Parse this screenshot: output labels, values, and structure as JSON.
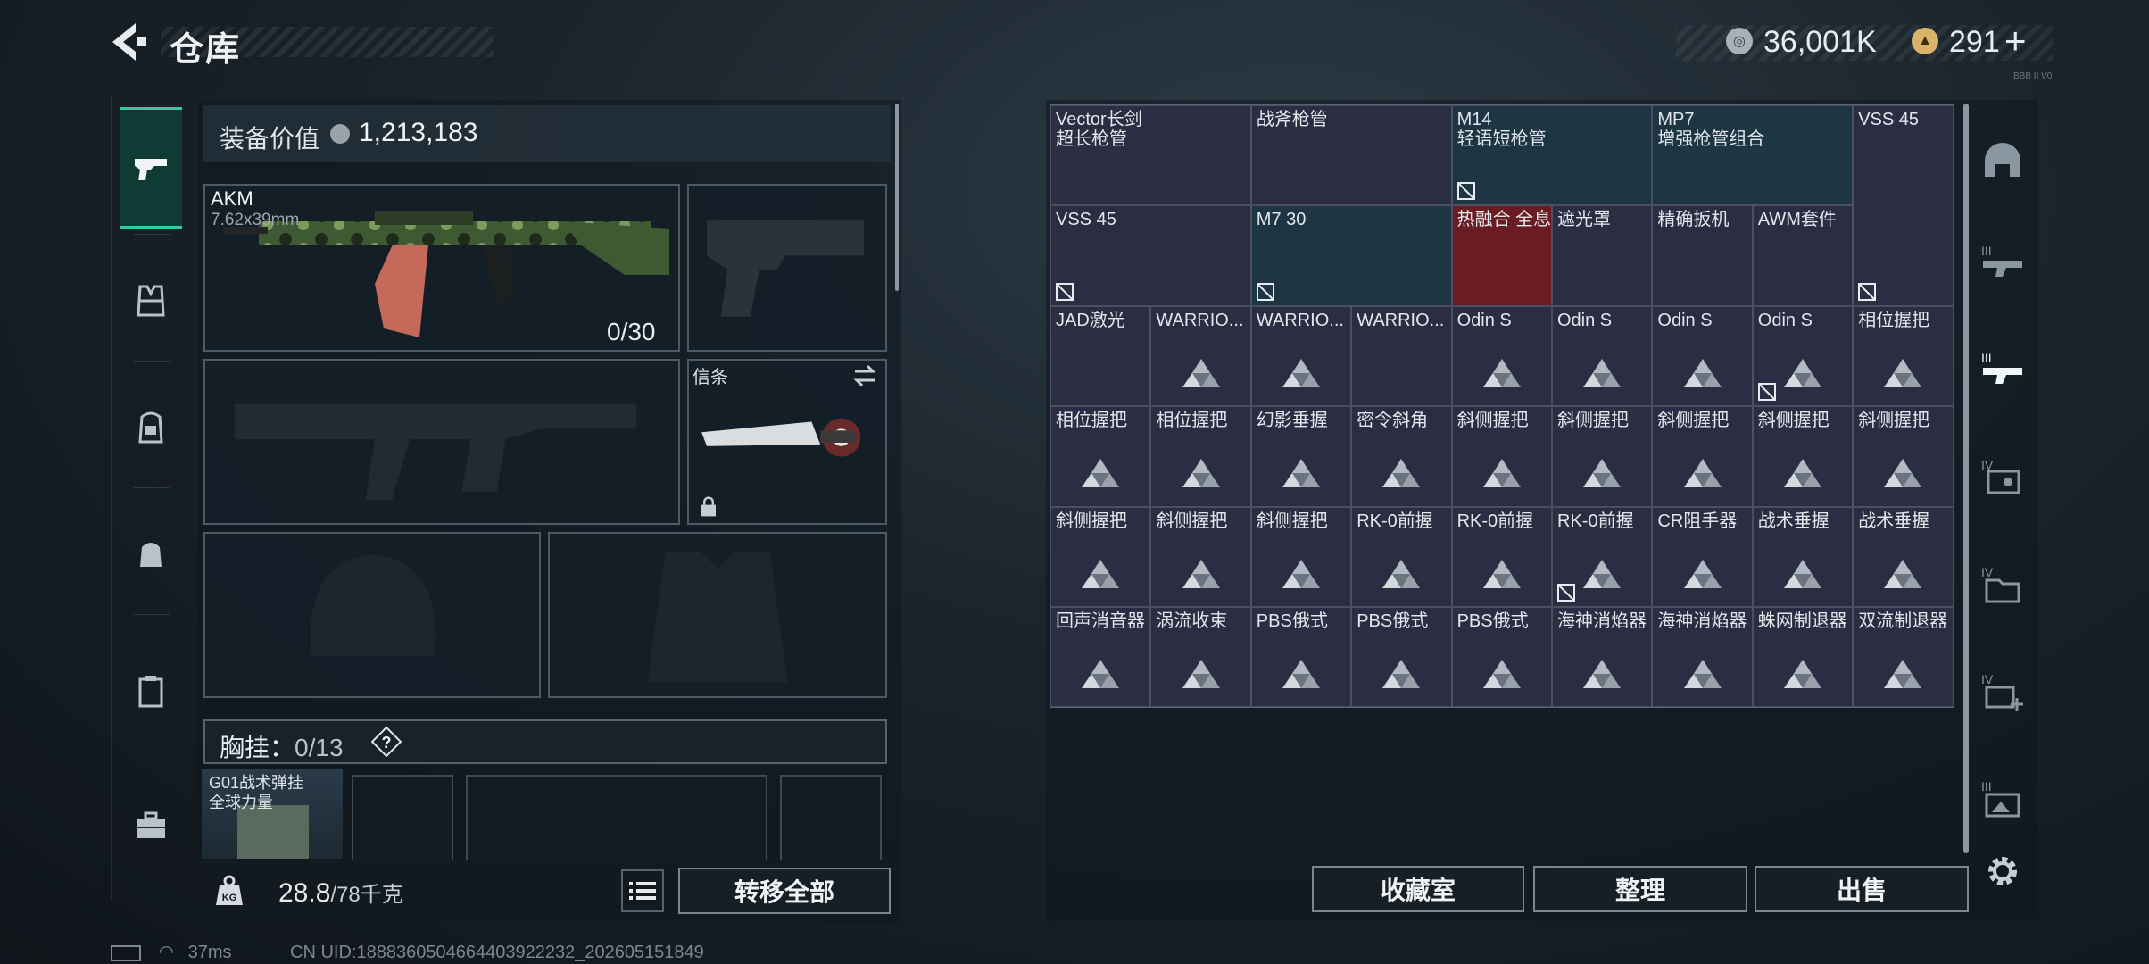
{
  "header": {
    "title": "仓库",
    "currency1": "36,001K",
    "currency2": "291",
    "plus": "+",
    "version": "BBB II V0"
  },
  "equipment": {
    "value_label": "装备价值",
    "value": "1,213,183",
    "primary": {
      "name": "AKM",
      "caliber": "7.62x39mm",
      "ammo": "0/30"
    },
    "knife_label": "信条",
    "chest_label": "胸挂：",
    "chest_count": "0/13",
    "chest_item": "G01战术弹挂\n全球力量",
    "weight": "28.8",
    "weight_max": "/78千克",
    "transfer_all": "转移全部"
  },
  "status": {
    "ping": "37ms",
    "uid": "CN UID:1888360504664403922232_202605151849"
  },
  "stash": {
    "items": [
      {
        "label": "Vector长剑\n超长枪管",
        "c": 0,
        "r": 0,
        "w": 2,
        "h": 1,
        "bg": "#2b2d42",
        "unk": false,
        "tri": false
      },
      {
        "label": "战斧枪管",
        "c": 2,
        "r": 0,
        "w": 2,
        "h": 1,
        "bg": "#2b2d42",
        "unk": false,
        "tri": false
      },
      {
        "label": "M14\n轻语短枪管",
        "c": 4,
        "r": 0,
        "w": 2,
        "h": 1,
        "bg": "#1e3644",
        "unk": true,
        "tri": false
      },
      {
        "label": "MP7\n增强枪管组合",
        "c": 6,
        "r": 0,
        "w": 2,
        "h": 1,
        "bg": "#1e3644",
        "unk": false,
        "tri": false
      },
      {
        "label": "VSS 45",
        "c": 8,
        "r": 0,
        "w": 1,
        "h": 2,
        "bg": "#2b2d42",
        "unk": true,
        "tri": false
      },
      {
        "label": "VSS 45",
        "c": 0,
        "r": 1,
        "w": 2,
        "h": 1,
        "bg": "#2b2d42",
        "unk": true,
        "tri": false
      },
      {
        "label": "M7 30",
        "c": 2,
        "r": 1,
        "w": 2,
        "h": 1,
        "bg": "#1e3644",
        "unk": true,
        "tri": false
      },
      {
        "label": "热融合 全息",
        "c": 4,
        "r": 1,
        "w": 1,
        "h": 1,
        "bg": "#6a1c22",
        "unk": false,
        "tri": false
      },
      {
        "label": "遮光罩",
        "c": 5,
        "r": 1,
        "w": 1,
        "h": 1,
        "bg": "#2b2d42",
        "unk": false,
        "tri": false
      },
      {
        "label": "精确扳机",
        "c": 6,
        "r": 1,
        "w": 1,
        "h": 1,
        "bg": "#2b2d42",
        "unk": false,
        "tri": false
      },
      {
        "label": "AWM套件",
        "c": 7,
        "r": 1,
        "w": 1,
        "h": 1,
        "bg": "#2b2d42",
        "unk": false,
        "tri": false
      },
      {
        "label": "JAD激光",
        "c": 0,
        "r": 2,
        "w": 1,
        "h": 1,
        "bg": "#2b2d42",
        "unk": false,
        "tri": false
      },
      {
        "label": "WARRIO...",
        "c": 1,
        "r": 2,
        "w": 1,
        "h": 1,
        "bg": "#2b2d42",
        "unk": false,
        "tri": true
      },
      {
        "label": "WARRIO...",
        "c": 2,
        "r": 2,
        "w": 1,
        "h": 1,
        "bg": "#2b2d42",
        "unk": false,
        "tri": true
      },
      {
        "label": "WARRIO...",
        "c": 3,
        "r": 2,
        "w": 1,
        "h": 1,
        "bg": "#2b2d42",
        "unk": false,
        "tri": false
      },
      {
        "label": "Odin S",
        "c": 4,
        "r": 2,
        "w": 1,
        "h": 1,
        "bg": "#2b2d42",
        "unk": false,
        "tri": true
      },
      {
        "label": "Odin S",
        "c": 5,
        "r": 2,
        "w": 1,
        "h": 1,
        "bg": "#2b2d42",
        "unk": false,
        "tri": true
      },
      {
        "label": "Odin S",
        "c": 6,
        "r": 2,
        "w": 1,
        "h": 1,
        "bg": "#2b2d42",
        "unk": false,
        "tri": true
      },
      {
        "label": "Odin S",
        "c": 7,
        "r": 2,
        "w": 1,
        "h": 1,
        "bg": "#2b2d42",
        "unk": true,
        "tri": true
      },
      {
        "label": "相位握把",
        "c": 8,
        "r": 2,
        "w": 1,
        "h": 1,
        "bg": "#2b2d42",
        "unk": false,
        "tri": true
      },
      {
        "label": "相位握把",
        "c": 0,
        "r": 3,
        "w": 1,
        "h": 1,
        "bg": "#2b2d42",
        "unk": false,
        "tri": true
      },
      {
        "label": "相位握把",
        "c": 1,
        "r": 3,
        "w": 1,
        "h": 1,
        "bg": "#2b2d42",
        "unk": false,
        "tri": true
      },
      {
        "label": "幻影垂握",
        "c": 2,
        "r": 3,
        "w": 1,
        "h": 1,
        "bg": "#2b2d42",
        "unk": false,
        "tri": true
      },
      {
        "label": "密令斜角",
        "c": 3,
        "r": 3,
        "w": 1,
        "h": 1,
        "bg": "#2b2d42",
        "unk": false,
        "tri": true
      },
      {
        "label": "斜侧握把",
        "c": 4,
        "r": 3,
        "w": 1,
        "h": 1,
        "bg": "#2b2d42",
        "unk": false,
        "tri": true
      },
      {
        "label": "斜侧握把",
        "c": 5,
        "r": 3,
        "w": 1,
        "h": 1,
        "bg": "#2b2d42",
        "unk": false,
        "tri": true
      },
      {
        "label": "斜侧握把",
        "c": 6,
        "r": 3,
        "w": 1,
        "h": 1,
        "bg": "#2b2d42",
        "unk": false,
        "tri": true
      },
      {
        "label": "斜侧握把",
        "c": 7,
        "r": 3,
        "w": 1,
        "h": 1,
        "bg": "#2b2d42",
        "unk": false,
        "tri": true
      },
      {
        "label": "斜侧握把",
        "c": 8,
        "r": 3,
        "w": 1,
        "h": 1,
        "bg": "#2b2d42",
        "unk": false,
        "tri": true
      },
      {
        "label": "斜侧握把",
        "c": 0,
        "r": 4,
        "w": 1,
        "h": 1,
        "bg": "#2b2d42",
        "unk": false,
        "tri": true
      },
      {
        "label": "斜侧握把",
        "c": 1,
        "r": 4,
        "w": 1,
        "h": 1,
        "bg": "#2b2d42",
        "unk": false,
        "tri": true
      },
      {
        "label": "斜侧握把",
        "c": 2,
        "r": 4,
        "w": 1,
        "h": 1,
        "bg": "#2b2d42",
        "unk": false,
        "tri": true
      },
      {
        "label": "RK-0前握",
        "c": 3,
        "r": 4,
        "w": 1,
        "h": 1,
        "bg": "#2b2d42",
        "unk": false,
        "tri": true
      },
      {
        "label": "RK-0前握",
        "c": 4,
        "r": 4,
        "w": 1,
        "h": 1,
        "bg": "#2b2d42",
        "unk": false,
        "tri": true
      },
      {
        "label": "RK-0前握",
        "c": 5,
        "r": 4,
        "w": 1,
        "h": 1,
        "bg": "#2b2d42",
        "unk": true,
        "tri": true
      },
      {
        "label": "CR阻手器",
        "c": 6,
        "r": 4,
        "w": 1,
        "h": 1,
        "bg": "#2b2d42",
        "unk": false,
        "tri": true
      },
      {
        "label": "战术垂握",
        "c": 7,
        "r": 4,
        "w": 1,
        "h": 1,
        "bg": "#2b2d42",
        "unk": false,
        "tri": true
      },
      {
        "label": "战术垂握",
        "c": 8,
        "r": 4,
        "w": 1,
        "h": 1,
        "bg": "#2b2d42",
        "unk": false,
        "tri": true
      },
      {
        "label": "回声消音器",
        "c": 0,
        "r": 5,
        "w": 1,
        "h": 1,
        "bg": "#2b2d42",
        "unk": false,
        "tri": true
      },
      {
        "label": "涡流收束",
        "c": 1,
        "r": 5,
        "w": 1,
        "h": 1,
        "bg": "#2b2d42",
        "unk": false,
        "tri": true
      },
      {
        "label": "PBS俄式",
        "c": 2,
        "r": 5,
        "w": 1,
        "h": 1,
        "bg": "#2b2d42",
        "unk": false,
        "tri": true
      },
      {
        "label": "PBS俄式",
        "c": 3,
        "r": 5,
        "w": 1,
        "h": 1,
        "bg": "#2b2d42",
        "unk": false,
        "tri": true
      },
      {
        "label": "PBS俄式",
        "c": 4,
        "r": 5,
        "w": 1,
        "h": 1,
        "bg": "#2b2d42",
        "unk": false,
        "tri": true
      },
      {
        "label": "海神消焰器",
        "c": 5,
        "r": 5,
        "w": 1,
        "h": 1,
        "bg": "#2b2d42",
        "unk": false,
        "tri": true
      },
      {
        "label": "海神消焰器",
        "c": 6,
        "r": 5,
        "w": 1,
        "h": 1,
        "bg": "#2b2d42",
        "unk": false,
        "tri": true
      },
      {
        "label": "蛛网制退器",
        "c": 7,
        "r": 5,
        "w": 1,
        "h": 1,
        "bg": "#2b2d42",
        "unk": false,
        "tri": true
      },
      {
        "label": "双流制退器",
        "c": 8,
        "r": 5,
        "w": 1,
        "h": 1,
        "bg": "#2b2d42",
        "unk": false,
        "tri": true
      }
    ],
    "buttons": {
      "collection": "收藏室",
      "sort": "整理",
      "sell": "出售"
    }
  },
  "side_tabs": [
    "weapon",
    "vest",
    "backpack-alt",
    "backpack",
    "case",
    "toolbox"
  ],
  "right_tabs": [
    "helmet",
    "level3-gun",
    "level3-gun-active",
    "level4-card",
    "level4-folder",
    "level4-medkit",
    "level3-photo"
  ],
  "colors": {
    "accent": "#36c9a6",
    "item_purple": "#2b2d42",
    "item_blue": "#1e3644",
    "item_red": "#6a1c22"
  }
}
